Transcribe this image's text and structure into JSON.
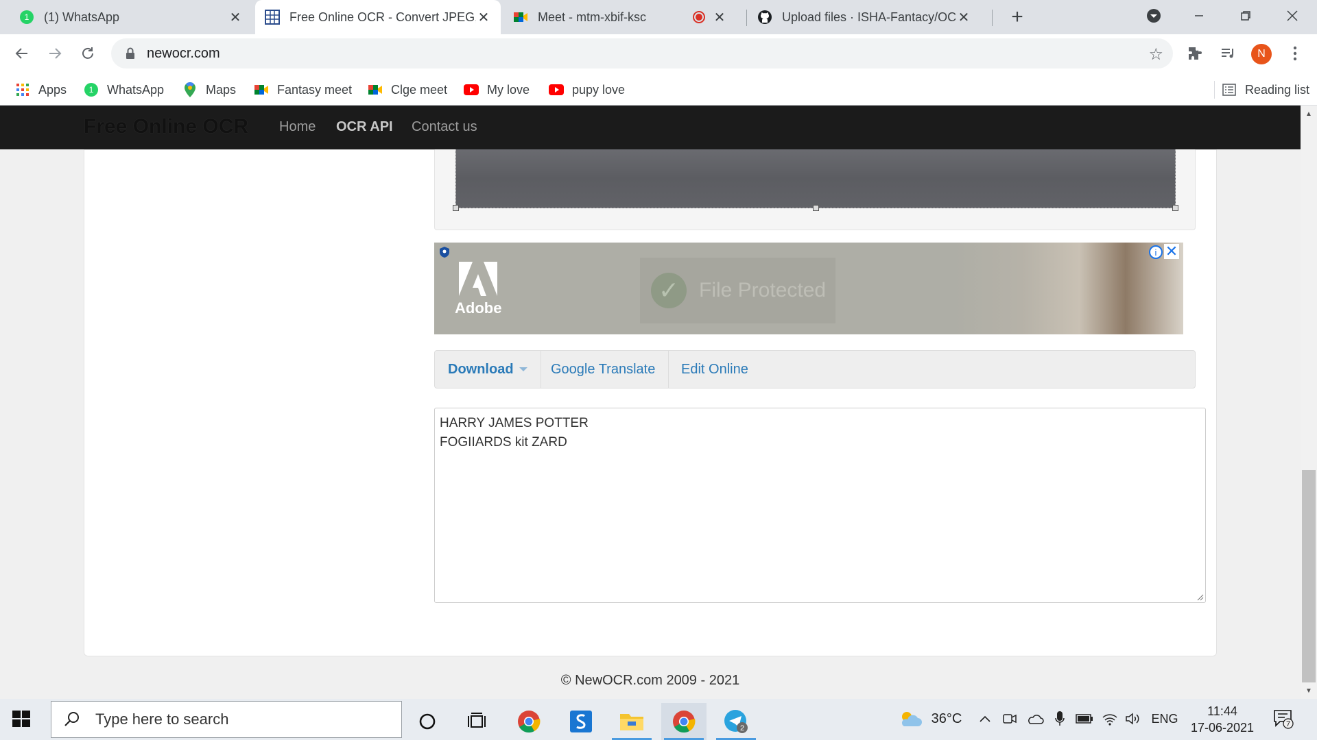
{
  "browser": {
    "tabs": [
      {
        "title": "(1) WhatsApp",
        "icon": "whatsapp-icon",
        "active": false
      },
      {
        "title": "Free Online OCR - Convert JPEG, PNG",
        "icon": "ocr-site-icon",
        "active": true
      },
      {
        "title": "Meet - mtm-xbif-ksc",
        "icon": "google-meet-icon",
        "active": false,
        "recording": true
      },
      {
        "title": "Upload files · ISHA-Fantacy/OCR",
        "icon": "github-icon",
        "active": false
      }
    ],
    "url": "newocr.com",
    "avatar_letter": "N",
    "bookmarks": [
      {
        "label": "Apps",
        "icon": "apps-grid-icon"
      },
      {
        "label": "WhatsApp",
        "icon": "whatsapp-icon"
      },
      {
        "label": "Maps",
        "icon": "maps-pin-icon"
      },
      {
        "label": "Fantasy meet",
        "icon": "google-meet-icon"
      },
      {
        "label": "Clge meet",
        "icon": "google-meet-icon"
      },
      {
        "label": "My love",
        "icon": "youtube-icon"
      },
      {
        "label": "pupy love",
        "icon": "youtube-icon"
      }
    ],
    "reading_list": "Reading list"
  },
  "site": {
    "brand": "Free Online OCR",
    "nav": [
      "Home",
      "OCR API",
      "Contact us"
    ],
    "ad": {
      "logo_word": "Adobe",
      "message": "File Protected"
    },
    "actions": {
      "download": "Download",
      "translate": "Google Translate",
      "edit": "Edit Online"
    },
    "result_lines": [
      "HARRY JAMES POTTER",
      "FOGIIARDS kit ZARD"
    ],
    "footer": "© NewOCR.com 2009 - 2021"
  },
  "taskbar": {
    "search_placeholder": "Type here to search",
    "weather": "36°C",
    "language": "ENG",
    "time": "11:44",
    "date": "17-06-2021",
    "notification_count": "7",
    "telegram_badge": "2"
  },
  "colors": {
    "accent": "#2a7ab8",
    "navbar": "#1b1b1b",
    "avatar": "#e8541a"
  }
}
